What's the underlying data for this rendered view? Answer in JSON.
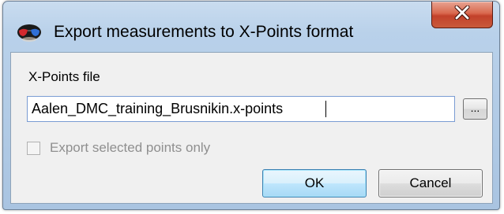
{
  "dialog": {
    "title": "Export measurements to X-Points format",
    "icon": "glasses-app-icon",
    "close_icon": "close-x-icon"
  },
  "form": {
    "file_label": "X-Points file",
    "file_value": "Aalen_DMC_training_Brusnikin.x-points",
    "browse_label": "...",
    "checkbox_label": "Export selected points only",
    "checkbox_checked": false,
    "checkbox_enabled": false
  },
  "buttons": {
    "ok_label": "OK",
    "cancel_label": "Cancel"
  },
  "colors": {
    "frame": "#b9d1ea",
    "close_button": "#c2412a",
    "default_button_border": "#3c7fb1",
    "disabled_text": "#8f8f8f"
  }
}
